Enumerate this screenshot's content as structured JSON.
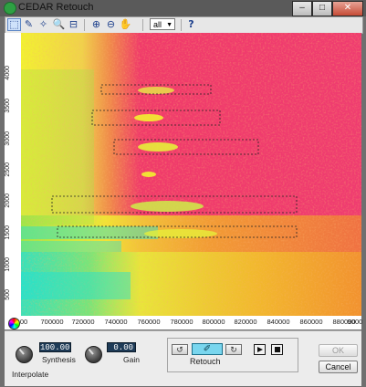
{
  "window": {
    "title": "CEDAR Retouch",
    "controls": {
      "minimize": "–",
      "maximize": "□",
      "close": "✕"
    }
  },
  "toolbar": {
    "buttons": [
      {
        "name": "select-rect-tool",
        "icon": "rect-select-icon",
        "glyph": "⬚"
      },
      {
        "name": "freehand-select-tool",
        "icon": "lasso-icon",
        "glyph": "✎"
      },
      {
        "name": "magic-select-tool",
        "icon": "wand-icon",
        "glyph": "✧"
      },
      {
        "name": "zoom-tool",
        "icon": "magnifier-icon",
        "glyph": "🔍"
      },
      {
        "name": "fit-tool",
        "icon": "fit-icon",
        "glyph": "⊟"
      },
      {
        "name": "zoom-in-button",
        "icon": "zoom-in-icon",
        "glyph": "⊕"
      },
      {
        "name": "zoom-out-button",
        "icon": "zoom-out-icon",
        "glyph": "⊖"
      },
      {
        "name": "pan-tool",
        "icon": "hand-icon",
        "glyph": "✋"
      },
      {
        "name": "help-button",
        "icon": "help-icon",
        "glyph": "?"
      }
    ],
    "zoom_value": "all"
  },
  "spectrogram": {
    "y_ticks": [
      "4000",
      "3500",
      "3000",
      "2500",
      "2000",
      "1500",
      "1000",
      "500"
    ],
    "x_ticks": [
      "00",
      "700000",
      "720000",
      "740000",
      "760000",
      "780000",
      "800000",
      "820000",
      "840000",
      "860000",
      "880000",
      "9000"
    ],
    "colors": {
      "low": "#1ee0d8",
      "mid_low": "#8be64d",
      "mid": "#f2f230",
      "mid_high": "#f29a2a",
      "high": "#f03a6a"
    }
  },
  "controls": {
    "synthesis": {
      "label": "Synthesis",
      "value": "100.00"
    },
    "gain": {
      "label": "Gain",
      "value": "0.00"
    },
    "interpolate_label": "Interpolate",
    "retouch_label": "Retouch",
    "ok_label": "OK",
    "cancel_label": "Cancel"
  }
}
